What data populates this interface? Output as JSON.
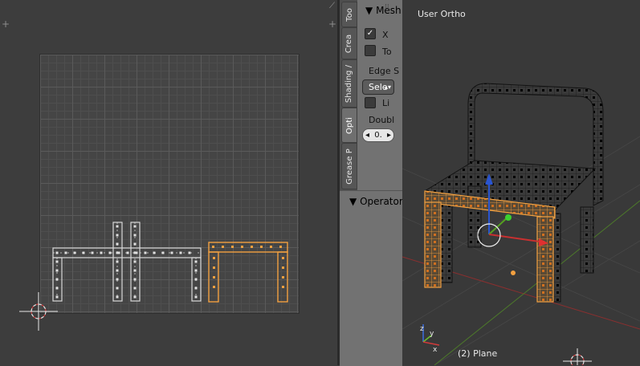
{
  "uv_editor": {
    "corner_buttons": [
      "+",
      "+"
    ]
  },
  "tool_shelf": {
    "tabs": [
      "Too",
      "Crea",
      "Shading /",
      "Opti",
      "Grease P"
    ],
    "active_tab": "Opti",
    "mesh_panel": {
      "title": "Mesh",
      "x_mirror": {
        "label": "X",
        "checked": true
      },
      "topology_mirror": {
        "label": "To",
        "checked": false
      },
      "edge_select_label": "Edge S",
      "edge_select_value": "Sele",
      "live_unwrap": {
        "label": "Li",
        "checked": false
      },
      "double_threshold_label": "Doubl",
      "double_threshold_value": "0."
    },
    "operator_panel": {
      "title": "Operator"
    }
  },
  "viewport": {
    "view_label": "User Ortho",
    "object_label": "(2) Plane"
  },
  "colors": {
    "selected": "#f2a040",
    "unselected": "#111111",
    "grid_minor": "#4e4e4e",
    "grid_major": "#5a5a5a",
    "axis_x": "#c83030",
    "axis_y": "#56a020",
    "axis_z": "#2a55d0"
  }
}
